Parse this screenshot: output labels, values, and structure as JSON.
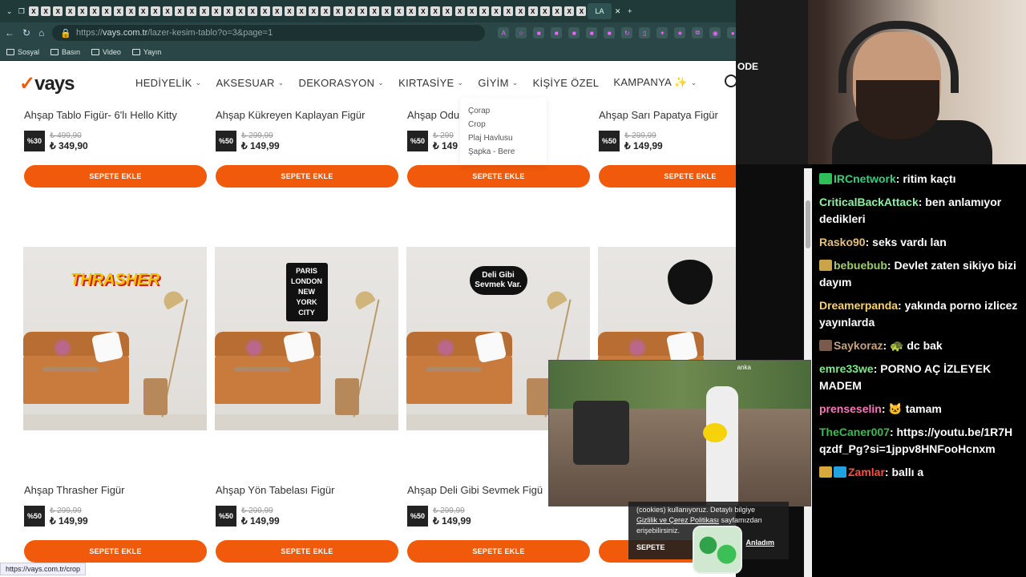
{
  "browser": {
    "tab_active_label": "LA",
    "address": {
      "prefix": "https://",
      "host": "vays.com.tr",
      "path": "/lazer-kesim-tablo?o=3&page=1"
    },
    "bookmarks": [
      "Sosyal",
      "Basın",
      "Video",
      "Yayın"
    ],
    "status_url": "https://vays.com.tr/crop"
  },
  "site": {
    "logo": "vays",
    "menu": [
      "HEDİYELİK",
      "AKSESUAR",
      "DEKORASYON",
      "KIRTASİYE",
      "GİYİM",
      "KİŞİYE ÖZEL",
      "KAMPANYA ✨"
    ],
    "dropdown": [
      "Çorap",
      "Crop",
      "Plaj Havlusu",
      "Şapka - Bere"
    ],
    "cart_label": "SEPETE EKLE",
    "row1": [
      {
        "name": "Ahşap Tablo Figür- 6'lı Hello Kitty",
        "badge": "%30",
        "old": "₺ 499,90",
        "new": "₺ 349,90"
      },
      {
        "name": "Ahşap Kükreyen Kaplayan Figür",
        "badge": "%50",
        "old": "₺ 299,99",
        "new": "₺ 149,99"
      },
      {
        "name": "Ahşap Odu",
        "badge": "%50",
        "old": "₺ 299",
        "new": "₺ 149"
      },
      {
        "name": "Ahşap Sarı Papatya Figür",
        "badge": "%50",
        "old": "₺ 299,99",
        "new": "₺ 149,99"
      }
    ],
    "row2": [
      {
        "name": "Ahşap Thrasher Figür",
        "badge": "%50",
        "old": "₺ 299,99",
        "new": "₺ 149,99",
        "art": "THRASHER"
      },
      {
        "name": "Ahşap Yön Tabelası Figür",
        "badge": "%50",
        "old": "₺ 299,99",
        "new": "₺ 149,99",
        "art": "PARIS LONDON NEW YORK CITY"
      },
      {
        "name": "Ahşap Deli Gibi Sevmek Figü",
        "badge": "%50",
        "old": "₺ 299,99",
        "new": "₺ 149,99",
        "art": "Deli Gibi Sevmek Var."
      },
      {
        "name": "",
        "badge": "",
        "old": "",
        "new": "",
        "art": ""
      }
    ],
    "cookie": {
      "line1": "(cookies) kullanıyoruz. Detaylı bilgiye",
      "link": "Gizlilik ve Çerez Politikası",
      "line2": "sayfamızdan",
      "line3": "erişebilirsiniz.",
      "ok": "Anladım",
      "cart_peek": "SEPETE"
    }
  },
  "video": {
    "watermark": "anka"
  },
  "webcam": {
    "label": "ODE"
  },
  "chat": [
    {
      "user": "IRCnetwork",
      "color": "#33d17a",
      "text": "ritim kaçtı",
      "emote": "#2fbf5a"
    },
    {
      "user": "CriticalBackAttack",
      "color": "#8ff0a4",
      "text": "ben anlamıyor dedikleri",
      "emote": ""
    },
    {
      "user": "Rasko90",
      "color": "#e5c07b",
      "text": "seks vardı lan",
      "emote": ""
    },
    {
      "user": "bebuebub",
      "color": "#9ece6a",
      "text": "Devlet zaten sikiyo bizi dayım",
      "emote": "#c9a54a"
    },
    {
      "user": "Dreamerpanda",
      "color": "#f6d365",
      "text": "yakında porno izlicez yayınlarda",
      "emote": ""
    },
    {
      "user": "Saykoraz",
      "color": "#c8a27c",
      "text": "🐢 dc bak",
      "emote": "#7a5a4a"
    },
    {
      "user": "emre33we",
      "color": "#7ee787",
      "text": "PORNO AÇ İZLEYEK MADEM",
      "emote": ""
    },
    {
      "user": "prenseselin",
      "color": "#f778ba",
      "text": "🐱 tamam",
      "emote": ""
    },
    {
      "user": "TheCaner007",
      "color": "#3fb950",
      "text": "https://youtu.be/1R7Hqzdf_Pg?si=1jppv8HNFooHcnxm",
      "emote": ""
    },
    {
      "user": "Zamlar",
      "color": "#f85149",
      "text": "ballı a",
      "emote": "#d6a93a"
    }
  ]
}
